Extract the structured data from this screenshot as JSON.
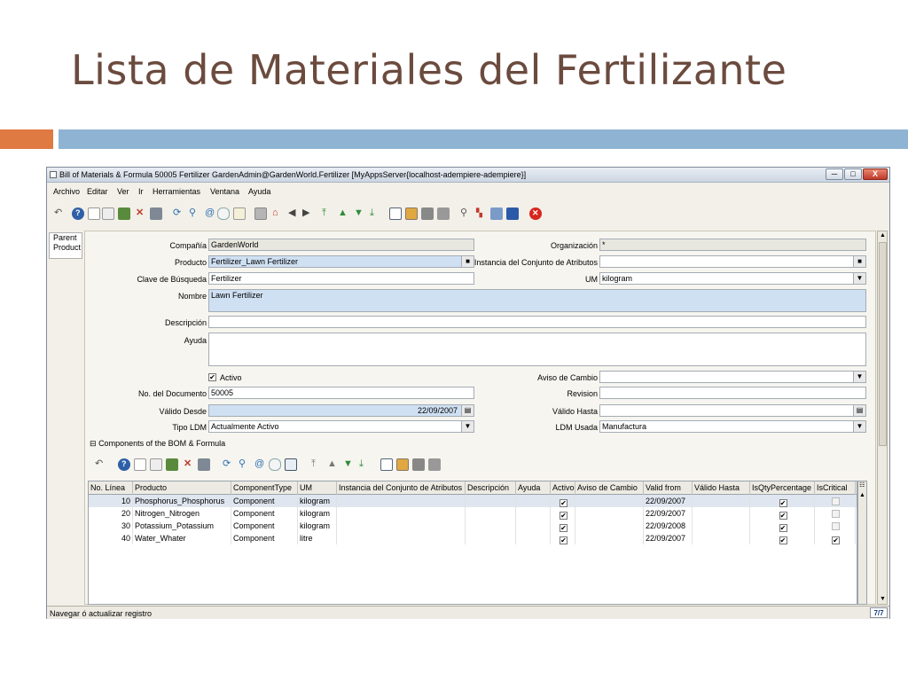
{
  "slide": {
    "title": "Lista de Materiales del Fertilizante",
    "accent_orange": "#df7a43",
    "accent_blue": "#8fb4d3"
  },
  "window": {
    "title": "Bill of Materials & Formula  50005  Fertilizer  GardenAdmin@GardenWorld.Fertilizer [MyAppsServer{localhost-adempiere-adempiere}]",
    "minimize": "─",
    "maximize": "□",
    "close": "X"
  },
  "menu": [
    "Archivo",
    "Editar",
    "Ver",
    "Ir",
    "Herramientas",
    "Ventana",
    "Ayuda"
  ],
  "side_tab": {
    "line1": "Parent",
    "line2": "Product"
  },
  "form": {
    "compania_label": "Compañía",
    "compania_value": "GardenWorld",
    "organizacion_label": "Organización",
    "organizacion_value": "*",
    "producto_label": "Producto",
    "producto_value": "Fertilizer_Lawn Fertilizer",
    "instancia_label": "Instancia del Conjunto de Atributos",
    "instancia_value": "",
    "clave_label": "Clave de Búsqueda",
    "clave_value": "Fertilizer",
    "um_label": "UM",
    "um_value": "kilogram",
    "nombre_label": "Nombre",
    "nombre_value": "Lawn Fertilizer",
    "descripcion_label": "Descripción",
    "descripcion_value": "",
    "ayuda_label": "Ayuda",
    "ayuda_value": "",
    "activo_label": "Activo",
    "aviso_label": "Aviso de Cambio",
    "aviso_value": "",
    "nodoc_label": "No. del Documento",
    "nodoc_value": "50005",
    "revision_label": "Revision",
    "revision_value": "",
    "valido_desde_label": "Válido Desde",
    "valido_desde_value": "22/09/2007",
    "valido_hasta_label": "Válido Hasta",
    "valido_hasta_value": "",
    "tipo_ldm_label": "Tipo LDM",
    "tipo_ldm_value": "Actualmente Activo",
    "ldm_usada_label": "LDM Usada",
    "ldm_usada_value": "Manufactura"
  },
  "components": {
    "section_label": "Components of the BOM & Formula",
    "columns": [
      "No. Línea",
      "Producto",
      "ComponentType",
      "UM",
      "Instancia del Conjunto de Atributos",
      "Descripción",
      "Ayuda",
      "Activo",
      "Aviso de Cambio",
      "Valid from",
      "Válido Hasta",
      "IsQtyPercentage",
      "IsCritical"
    ],
    "rows": [
      {
        "line": "10",
        "product": "Phosphorus_Phosphorus",
        "type": "Component",
        "um": "kilogram",
        "activo": true,
        "valid_from": "22/09/2007",
        "qty_pct": true,
        "critical": false
      },
      {
        "line": "20",
        "product": "Nitrogen_Nitrogen",
        "type": "Component",
        "um": "kilogram",
        "activo": true,
        "valid_from": "22/09/2007",
        "qty_pct": true,
        "critical": false
      },
      {
        "line": "30",
        "product": "Potassium_Potassium",
        "type": "Component",
        "um": "kilogram",
        "activo": true,
        "valid_from": "22/09/2008",
        "qty_pct": true,
        "critical": false
      },
      {
        "line": "40",
        "product": "Water_Whater",
        "type": "Component",
        "um": "litre",
        "activo": true,
        "valid_from": "22/09/2007",
        "qty_pct": true,
        "critical": true
      }
    ]
  },
  "status": {
    "text": "Navegar ó actualizar registro",
    "record_count": "7/7"
  },
  "icons": {
    "check": "✔",
    "dropdown": "▼",
    "lookup": "■",
    "calendar": "▤",
    "collapse": "⊟",
    "scroll_up": "▲",
    "scroll_down": "▼",
    "grid_menu": "☷"
  }
}
